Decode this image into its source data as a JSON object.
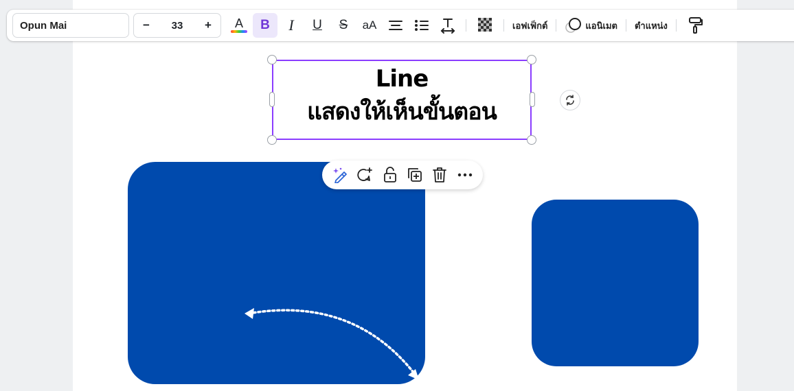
{
  "toolbar": {
    "font_name": "Opun Mai",
    "font_size": "33",
    "decrease_label": "−",
    "increase_label": "+",
    "text_color_label": "A",
    "bold_label": "B",
    "italic_label": "I",
    "underline_label": "U",
    "strikethrough_label": "S",
    "case_label": "aA",
    "effects_label": "เอฟเฟ็กต์",
    "animate_label": "แอนิเมต",
    "position_label": "ตำแหน่ง"
  },
  "textbox": {
    "line1": "Line",
    "line2": "แสดงให้เห็นขั้นตอน"
  },
  "colors": {
    "shape_fill": "#004aad",
    "selection": "#8b3dff",
    "bold_active_bg": "#ece7fb"
  },
  "icons": {
    "text_color": "text-color-icon",
    "align": "align-center-icon",
    "list": "bullet-list-icon",
    "spacing": "spacing-icon",
    "transparency": "transparency-icon",
    "paint_format": "paint-roller-icon",
    "rotate": "rotate-icon",
    "magic": "magic-edit-icon",
    "comment": "add-comment-icon",
    "lock": "lock-icon",
    "duplicate": "duplicate-icon",
    "delete": "trash-icon",
    "more": "more-icon"
  }
}
